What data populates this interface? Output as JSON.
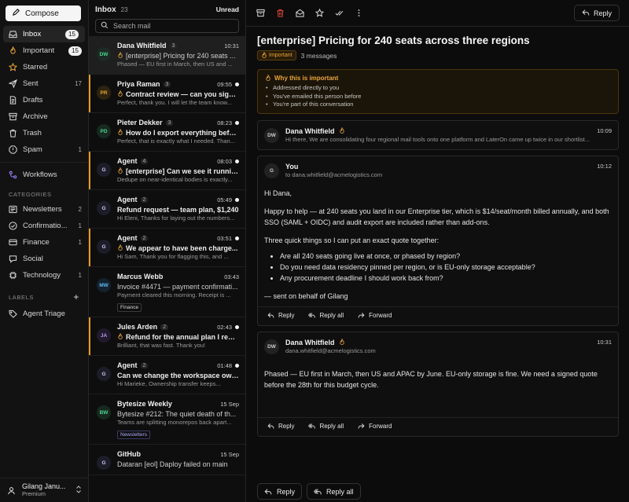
{
  "colors": {
    "accent": "#e89a1c",
    "background": "#0c0c0c",
    "sidebar": "#121212"
  },
  "sidebar": {
    "compose_label": "Compose",
    "items": [
      {
        "label": "Inbox",
        "count": "15",
        "icon": "inbox-icon",
        "badge": true,
        "active": true
      },
      {
        "label": "Important",
        "count": "15",
        "icon": "fire-icon",
        "badge": true
      },
      {
        "label": "Starred",
        "count": "",
        "icon": "star-icon"
      },
      {
        "label": "Sent",
        "count": "17",
        "icon": "send-icon"
      },
      {
        "label": "Drafts",
        "count": "",
        "icon": "draft-icon"
      },
      {
        "label": "Archive",
        "count": "",
        "icon": "archive-icon"
      },
      {
        "label": "Trash",
        "count": "",
        "icon": "trash-icon"
      },
      {
        "label": "Spam",
        "count": "1",
        "icon": "spam-icon"
      }
    ],
    "workflows_label": "Workflows",
    "categories_label": "CATEGORIES",
    "categories": [
      {
        "label": "Newsletters",
        "count": "2"
      },
      {
        "label": "Confirmatio...",
        "count": "1"
      },
      {
        "label": "Finance",
        "count": "1"
      },
      {
        "label": "Social",
        "count": ""
      },
      {
        "label": "Technology",
        "count": "1"
      }
    ],
    "labels_label": "LABELS",
    "labels": [
      {
        "label": "Agent Triage"
      }
    ],
    "user": {
      "name": "Gilang Janu...",
      "plan": "Premium"
    }
  },
  "list": {
    "title": "Inbox",
    "count": "23",
    "filter": "Unread",
    "search_placeholder": "Search mail",
    "items": [
      {
        "initials": "DW",
        "sender": "Dana Whitfield",
        "threads": "3",
        "time": "10:31",
        "subject": "[enterprise] Pricing for 240 seats ...",
        "preview": "Phased — EU first in March, then US and ...",
        "fire": true,
        "unread": false,
        "selected": true,
        "flagged": false,
        "tag": "",
        "avatar_bg": "#1c2b24",
        "avatar_fg": "#4fd38f"
      },
      {
        "initials": "PR",
        "sender": "Priya Raman",
        "threads": "3",
        "time": "09:55",
        "subject": "Contract review — can you sign ...",
        "preview": "Perfect, thank you. I will let the team know...",
        "fire": true,
        "unread": true,
        "selected": false,
        "flagged": true,
        "tag": "",
        "avatar_bg": "#2e2410",
        "avatar_fg": "#e8a53a"
      },
      {
        "initials": "PD",
        "sender": "Pieter Dekker",
        "threads": "3",
        "time": "08:23",
        "subject": "How do I export everything befor...",
        "preview": "Perfect, that is exactly what I needed. Than...",
        "fire": true,
        "unread": true,
        "selected": false,
        "flagged": false,
        "tag": "",
        "avatar_bg": "#172a20",
        "avatar_fg": "#4fd38f"
      },
      {
        "initials": "G",
        "sender": "Agent",
        "threads": "4",
        "time": "08:03",
        "subject": "[enterprise] Can we see it running...",
        "preview": "Dedupe on near-identical bodies is exactly...",
        "fire": true,
        "unread": true,
        "selected": false,
        "flagged": true,
        "tag": "",
        "avatar_bg": "#1d1d2a",
        "avatar_fg": "#c9c9f0"
      },
      {
        "initials": "G",
        "sender": "Agent",
        "threads": "2",
        "time": "05:49",
        "subject": "Refund request — team plan, $1,240",
        "preview": "Hi Eleni, Thanks for laying out the numbers...",
        "fire": false,
        "unread": true,
        "selected": false,
        "flagged": false,
        "tag": "",
        "avatar_bg": "#1d1d2a",
        "avatar_fg": "#c9c9f0"
      },
      {
        "initials": "G",
        "sender": "Agent",
        "threads": "2",
        "time": "03:51",
        "subject": "We appear to have been charge...",
        "preview": "Hi Sam, Thank you for flagging this, and ...",
        "fire": true,
        "unread": true,
        "selected": false,
        "flagged": true,
        "tag": "",
        "avatar_bg": "#1d1d2a",
        "avatar_fg": "#c9c9f0"
      },
      {
        "initials": "MW",
        "sender": "Marcus Webb",
        "threads": "",
        "time": "03:43",
        "subject": "Invoice #4471 — payment confirmati...",
        "preview": "Payment cleared this morning. Receipt is ...",
        "fire": false,
        "unread": false,
        "selected": false,
        "flagged": false,
        "tag": "Finance",
        "avatar_bg": "#13222e",
        "avatar_fg": "#5fb8f0"
      },
      {
        "initials": "JA",
        "sender": "Jules Arden",
        "threads": "2",
        "time": "02:43",
        "subject": "Refund for the annual plan I rene...",
        "preview": "Brilliant, that was fast. Thank you!",
        "fire": true,
        "unread": true,
        "selected": false,
        "flagged": true,
        "tag": "",
        "avatar_bg": "#201a2c",
        "avatar_fg": "#b99af0"
      },
      {
        "initials": "G",
        "sender": "Agent",
        "threads": "2",
        "time": "01:48",
        "subject": "Can we change the workspace own...",
        "preview": "Hi Marieke, Ownership transfer keeps...",
        "fire": false,
        "unread": true,
        "selected": false,
        "flagged": false,
        "tag": "",
        "avatar_bg": "#1d1d2a",
        "avatar_fg": "#c9c9f0"
      },
      {
        "initials": "BW",
        "sender": "Bytesize Weekly",
        "threads": "",
        "time": "15 Sep",
        "subject": "Bytesize #212: The quiet death of th...",
        "preview": "Teams are splitting monorepos back apart...",
        "fire": false,
        "unread": false,
        "selected": false,
        "flagged": false,
        "tag": "Newsletters",
        "avatar_bg": "#172a20",
        "avatar_fg": "#4fd38f"
      },
      {
        "initials": "G",
        "sender": "GitHub",
        "threads": "",
        "time": "15 Sep",
        "subject": "Dataran [eol] Daploy failed on main",
        "preview": "",
        "fire": false,
        "unread": false,
        "selected": false,
        "flagged": false,
        "tag": "",
        "avatar_bg": "#1d1d2a",
        "avatar_fg": "#c9c9f0"
      }
    ]
  },
  "thread": {
    "reply_label": "Reply",
    "title": "[enterprise] Pricing for 240 seats across three regions",
    "badge": "Important",
    "messages_count": "3 messages",
    "why": {
      "title": "Why this is important",
      "reasons": [
        "Addressed directly to you",
        "You've emailed this person before",
        "You're part of this conversation"
      ]
    },
    "messages": [
      {
        "initials": "DW",
        "name": "Dana Whitfield",
        "time": "10:09",
        "sub": "Hi there, We are consolidating four regional mail tools onto one platform and LaterOn came up twice in our shortlist..."
      },
      {
        "initials": "G",
        "name": "You",
        "time": "10:12",
        "sub": "to dana.whitfield@acmelogistics.com",
        "greeting": "Hi Dana,",
        "p1": "Happy to help — at 240 seats you land in our Enterprise tier, which is $14/seat/month billed annually, and both SSO (SAML + OIDC) and audit export are included rather than add-ons.",
        "p2": "Three quick things so I can put an exact quote together:",
        "bullets": [
          "Are all 240 seats going live at once, or phased by region?",
          "Do you need data residency pinned per region, or is EU-only storage acceptable?",
          "Any procurement deadline I should work back from?"
        ],
        "signoff": "— sent on behalf of Gilang"
      },
      {
        "initials": "DW",
        "name": "Dana Whitfield",
        "time": "10:31",
        "sub": "dana.whitfield@acmelogistics.com",
        "p1": "Phased — EU first in March, then US and APAC by June. EU-only storage is fine. We need a signed quote before the 28th for this budget cycle."
      }
    ],
    "actions": {
      "reply": "Reply",
      "reply_all": "Reply all",
      "forward": "Forward"
    },
    "bottom": {
      "reply": "Reply",
      "reply_all": "Reply all"
    }
  }
}
